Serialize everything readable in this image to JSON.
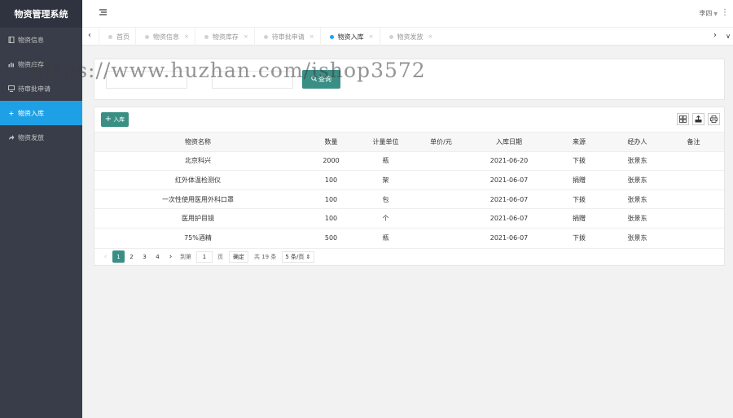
{
  "app": {
    "title": "物资管理系统"
  },
  "sidebar": {
    "items": [
      {
        "label": "物资信息",
        "icon": "book-icon"
      },
      {
        "label": "物资库存",
        "icon": "bar-chart-icon"
      },
      {
        "label": "待审批申请",
        "icon": "monitor-icon"
      },
      {
        "label": "物资入库",
        "icon": "plus-icon",
        "active": true
      },
      {
        "label": "物资发放",
        "icon": "share-icon"
      }
    ]
  },
  "header": {
    "user": "李四"
  },
  "tabs": [
    {
      "label": "首页"
    },
    {
      "label": "物资信息"
    },
    {
      "label": "物资库存"
    },
    {
      "label": "待审批申请"
    },
    {
      "label": "物资入库",
      "active": true
    },
    {
      "label": "物资发放"
    }
  ],
  "search": {
    "button_label": "查询"
  },
  "toolbar": {
    "add_label": "入库"
  },
  "table": {
    "columns": [
      "物资名称",
      "数量",
      "计量单位",
      "单价/元",
      "入库日期",
      "来源",
      "经办人",
      "备注"
    ],
    "rows": [
      [
        "北京科兴",
        "2000",
        "瓶",
        "",
        "2021-06-20",
        "下拨",
        "张景东",
        ""
      ],
      [
        "红外体温检测仪",
        "100",
        "架",
        "",
        "2021-06-07",
        "捐赠",
        "张景东",
        ""
      ],
      [
        "一次性使用医用外科口罩",
        "100",
        "包",
        "",
        "2021-06-07",
        "下拨",
        "张景东",
        ""
      ],
      [
        "医用护目镜",
        "100",
        "个",
        "",
        "2021-06-07",
        "捐赠",
        "张景东",
        ""
      ],
      [
        "75%酒精",
        "500",
        "瓶",
        "",
        "2021-06-07",
        "下拨",
        "张景东",
        ""
      ]
    ]
  },
  "pagination": {
    "pages": [
      "1",
      "2",
      "3",
      "4"
    ],
    "current": "1",
    "goto_label": "到第",
    "goto_value": "1",
    "page_unit": "页",
    "confirm_label": "确定",
    "total_label": "共 19 条",
    "page_size": "5 条/页"
  },
  "watermark": "https://www.huzhan.com/ishop3572",
  "colors": {
    "sidebar": "#393d49",
    "accent": "#3a8f85",
    "active_menu": "#1ea0e6"
  }
}
